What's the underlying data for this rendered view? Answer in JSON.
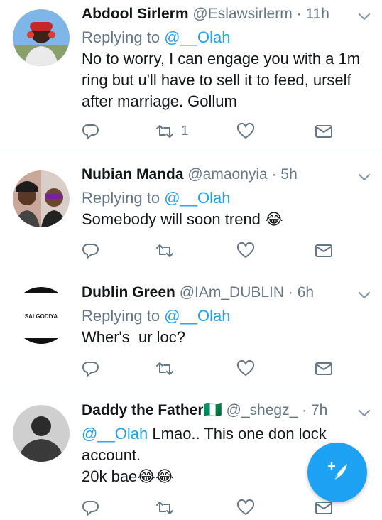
{
  "tweets": [
    {
      "name": "Abdool Sirlerm",
      "handle": "@Eslawsirlerm",
      "dot": "·",
      "time": "11h",
      "reply_prefix": "Replying to",
      "reply_to": "@__Olah",
      "text_lines": [
        "No to worry, I can engage you with a 1m",
        "ring but u'll have to sell it to feed, urself",
        "after marriage. Gollum"
      ],
      "retweet_count": "1"
    },
    {
      "name": "Nubian Manda",
      "handle": "@amaonyia",
      "dot": "·",
      "time": "5h",
      "reply_prefix": "Replying to",
      "reply_to": "@__Olah",
      "text": "Somebody will soon trend",
      "emoji": "😂"
    },
    {
      "name": "Dublin Green",
      "handle": "@IAm_DUBLIN",
      "dot": "·",
      "time": "6h",
      "reply_prefix": "Replying to",
      "reply_to": "@__Olah",
      "text": "Wher's  ur loc?",
      "avatar_text": "SAI GODIYA"
    },
    {
      "name": "Daddy the Father",
      "flag": "🇳🇬",
      "handle": "@_shegz_",
      "dot": "·",
      "time": "7h",
      "mention": "@__Olah",
      "text_after_mention": " Lmao.. This one don lock",
      "text_line2": "account.",
      "text_line3": "20k bae",
      "emoji": "😂"
    }
  ],
  "icons": {
    "reply": "reply-icon",
    "retweet": "retweet-icon",
    "like": "heart-icon",
    "dm": "envelope-icon",
    "caret": "chevron-down-icon",
    "compose": "compose-tweet-icon"
  },
  "colors": {
    "accent": "#1da1f2",
    "secondary_text": "#657786",
    "primary_text": "#14171a",
    "divider": "#e1e8ed"
  }
}
